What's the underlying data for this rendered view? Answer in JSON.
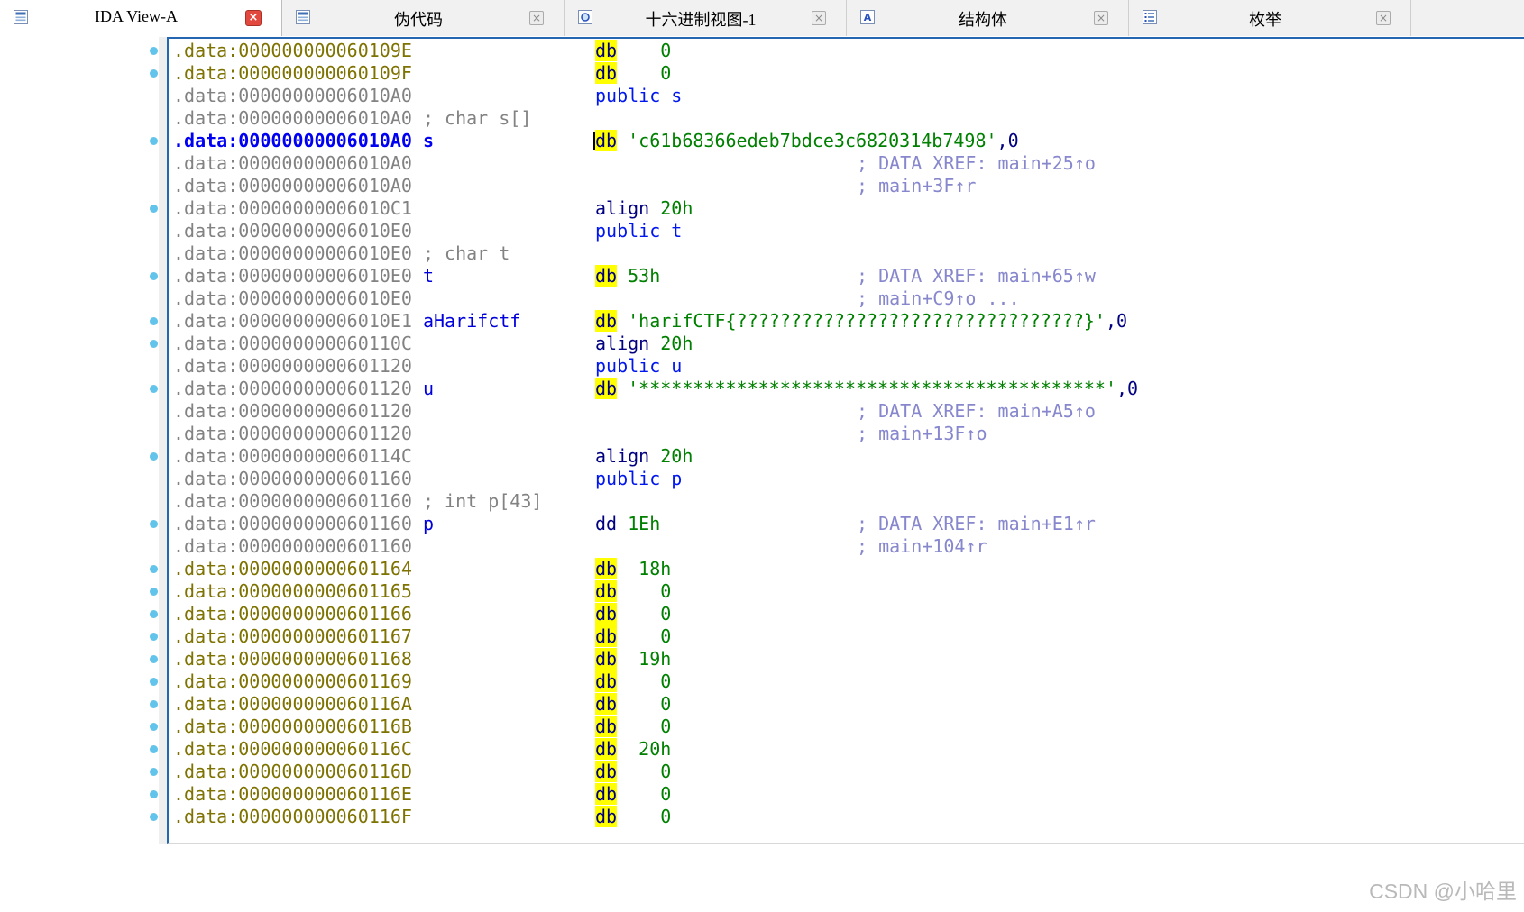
{
  "tabs": [
    {
      "label": "IDA View-A",
      "icon": "views-icon",
      "close": "red",
      "active": true
    },
    {
      "label": "伪代码",
      "icon": "views-icon",
      "close": "gray",
      "active": false
    },
    {
      "label": "十六进制视图-1",
      "icon": "hex-view-icon",
      "close": "gray",
      "active": false
    },
    {
      "label": "结构体",
      "icon": "structs-icon",
      "close": "gray",
      "active": false
    },
    {
      "label": "枚举",
      "icon": "enums-icon",
      "close": "gray",
      "active": false
    }
  ],
  "close_glyph": "×",
  "watermark": "CSDN @小哈里",
  "colors": {
    "pane_border": "#2467b0",
    "highlight": "#ffff00",
    "item_dot": "#62c4ea",
    "address_data": "#7e7200",
    "address_plain": "#828282",
    "address_selected": "#0000f2",
    "mnemonic": "#000080",
    "number_string": "#008000",
    "public_keyword": "#0016ef",
    "xref_comment": "#8787cd",
    "close_active": "#e2483d"
  },
  "listing": {
    "segment": ".data",
    "lines": [
      {
        "dot": true,
        "ac": "olive",
        "addr": ".data:000000000060109E",
        "code": [
          [
            "db",
            "hl"
          ],
          [
            "    0",
            "num"
          ]
        ]
      },
      {
        "dot": true,
        "ac": "olive",
        "addr": ".data:000000000060109F",
        "code": [
          [
            "db",
            "hl"
          ],
          [
            "    0",
            "num"
          ]
        ]
      },
      {
        "ac": "gray",
        "addr": ".data:00000000006010A0",
        "code": [
          [
            "public s",
            "pub"
          ]
        ]
      },
      {
        "ac": "gray",
        "addr": ".data:00000000006010A0 ; char s[]"
      },
      {
        "dot": true,
        "ac": "sel",
        "addr": ".data:00000000006010A0",
        "name": "s",
        "nc": "sel",
        "caret": true,
        "code": [
          [
            "db",
            "hl"
          ],
          [
            " ",
            ""
          ],
          [
            "'c61b68366edeb7bdce3c6820314b7498'",
            "str"
          ],
          [
            ",0",
            "punc"
          ]
        ]
      },
      {
        "ac": "gray",
        "addr": ".data:00000000006010A0",
        "cmt": "; DATA XREF: main+25↑o"
      },
      {
        "ac": "gray",
        "addr": ".data:00000000006010A0",
        "cmt": "; main+3F↑r"
      },
      {
        "dot": true,
        "ac": "gray",
        "addr": ".data:00000000006010C1",
        "code": [
          [
            "align",
            "mnem"
          ],
          [
            " 20h",
            "num"
          ]
        ]
      },
      {
        "ac": "gray",
        "addr": ".data:00000000006010E0",
        "code": [
          [
            "public t",
            "pub"
          ]
        ]
      },
      {
        "ac": "gray",
        "addr": ".data:00000000006010E0 ; char t"
      },
      {
        "dot": true,
        "ac": "gray",
        "addr": ".data:00000000006010E0",
        "name": "t",
        "code": [
          [
            "db",
            "hl"
          ],
          [
            " 53h",
            "num"
          ]
        ],
        "cmt": "; DATA XREF: main+65↑w"
      },
      {
        "ac": "gray",
        "addr": ".data:00000000006010E0",
        "cmt": "; main+C9↑o ..."
      },
      {
        "dot": true,
        "ac": "gray",
        "addr": ".data:00000000006010E1",
        "name": "aHarifctf",
        "code": [
          [
            "db",
            "hl"
          ],
          [
            " ",
            ""
          ],
          [
            "'harifCTF{????????????????????????????????}'",
            "str"
          ],
          [
            ",0",
            "punc"
          ]
        ]
      },
      {
        "dot": true,
        "ac": "gray",
        "addr": ".data:000000000060110C",
        "code": [
          [
            "align",
            "mnem"
          ],
          [
            " 20h",
            "num"
          ]
        ]
      },
      {
        "ac": "gray",
        "addr": ".data:0000000000601120",
        "code": [
          [
            "public u",
            "pub"
          ]
        ]
      },
      {
        "dot": true,
        "ac": "gray",
        "addr": ".data:0000000000601120",
        "name": "u",
        "code": [
          [
            "db",
            "hl"
          ],
          [
            " ",
            ""
          ],
          [
            "'*******************************************'",
            "str"
          ],
          [
            ",0",
            "punc"
          ]
        ]
      },
      {
        "ac": "gray",
        "addr": ".data:0000000000601120",
        "cmt": "; DATA XREF: main+A5↑o"
      },
      {
        "ac": "gray",
        "addr": ".data:0000000000601120",
        "cmt": "; main+13F↑o"
      },
      {
        "dot": true,
        "ac": "gray",
        "addr": ".data:000000000060114C",
        "code": [
          [
            "align",
            "mnem"
          ],
          [
            " 20h",
            "num"
          ]
        ]
      },
      {
        "ac": "gray",
        "addr": ".data:0000000000601160",
        "code": [
          [
            "public p",
            "pub"
          ]
        ]
      },
      {
        "ac": "gray",
        "addr": ".data:0000000000601160 ; int p[43]"
      },
      {
        "dot": true,
        "ac": "gray",
        "addr": ".data:0000000000601160",
        "name": "p",
        "code": [
          [
            "dd",
            "mnem"
          ],
          [
            " 1Eh",
            "num"
          ]
        ],
        "cmt": "; DATA XREF: main+E1↑r"
      },
      {
        "ac": "gray",
        "addr": ".data:0000000000601160",
        "cmt": "; main+104↑r"
      },
      {
        "dot": true,
        "ac": "olive",
        "addr": ".data:0000000000601164",
        "code": [
          [
            "db",
            "hl"
          ],
          [
            "  18h",
            "num"
          ]
        ]
      },
      {
        "dot": true,
        "ac": "olive",
        "addr": ".data:0000000000601165",
        "code": [
          [
            "db",
            "hl"
          ],
          [
            "    0",
            "num"
          ]
        ]
      },
      {
        "dot": true,
        "ac": "olive",
        "addr": ".data:0000000000601166",
        "code": [
          [
            "db",
            "hl"
          ],
          [
            "    0",
            "num"
          ]
        ]
      },
      {
        "dot": true,
        "ac": "olive",
        "addr": ".data:0000000000601167",
        "code": [
          [
            "db",
            "hl"
          ],
          [
            "    0",
            "num"
          ]
        ]
      },
      {
        "dot": true,
        "ac": "olive",
        "addr": ".data:0000000000601168",
        "code": [
          [
            "db",
            "hl"
          ],
          [
            "  19h",
            "num"
          ]
        ]
      },
      {
        "dot": true,
        "ac": "olive",
        "addr": ".data:0000000000601169",
        "code": [
          [
            "db",
            "hl"
          ],
          [
            "    0",
            "num"
          ]
        ]
      },
      {
        "dot": true,
        "ac": "olive",
        "addr": ".data:000000000060116A",
        "code": [
          [
            "db",
            "hl"
          ],
          [
            "    0",
            "num"
          ]
        ]
      },
      {
        "dot": true,
        "ac": "olive",
        "addr": ".data:000000000060116B",
        "code": [
          [
            "db",
            "hl"
          ],
          [
            "    0",
            "num"
          ]
        ]
      },
      {
        "dot": true,
        "ac": "olive",
        "addr": ".data:000000000060116C",
        "code": [
          [
            "db",
            "hl"
          ],
          [
            "  20h",
            "num"
          ]
        ]
      },
      {
        "dot": true,
        "ac": "olive",
        "addr": ".data:000000000060116D",
        "code": [
          [
            "db",
            "hl"
          ],
          [
            "    0",
            "num"
          ]
        ]
      },
      {
        "dot": true,
        "ac": "olive",
        "addr": ".data:000000000060116E",
        "code": [
          [
            "db",
            "hl"
          ],
          [
            "    0",
            "num"
          ]
        ]
      },
      {
        "dot": true,
        "ac": "olive",
        "addr": ".data:000000000060116F",
        "code": [
          [
            "db",
            "hl"
          ],
          [
            "    0",
            "num"
          ]
        ]
      }
    ]
  }
}
